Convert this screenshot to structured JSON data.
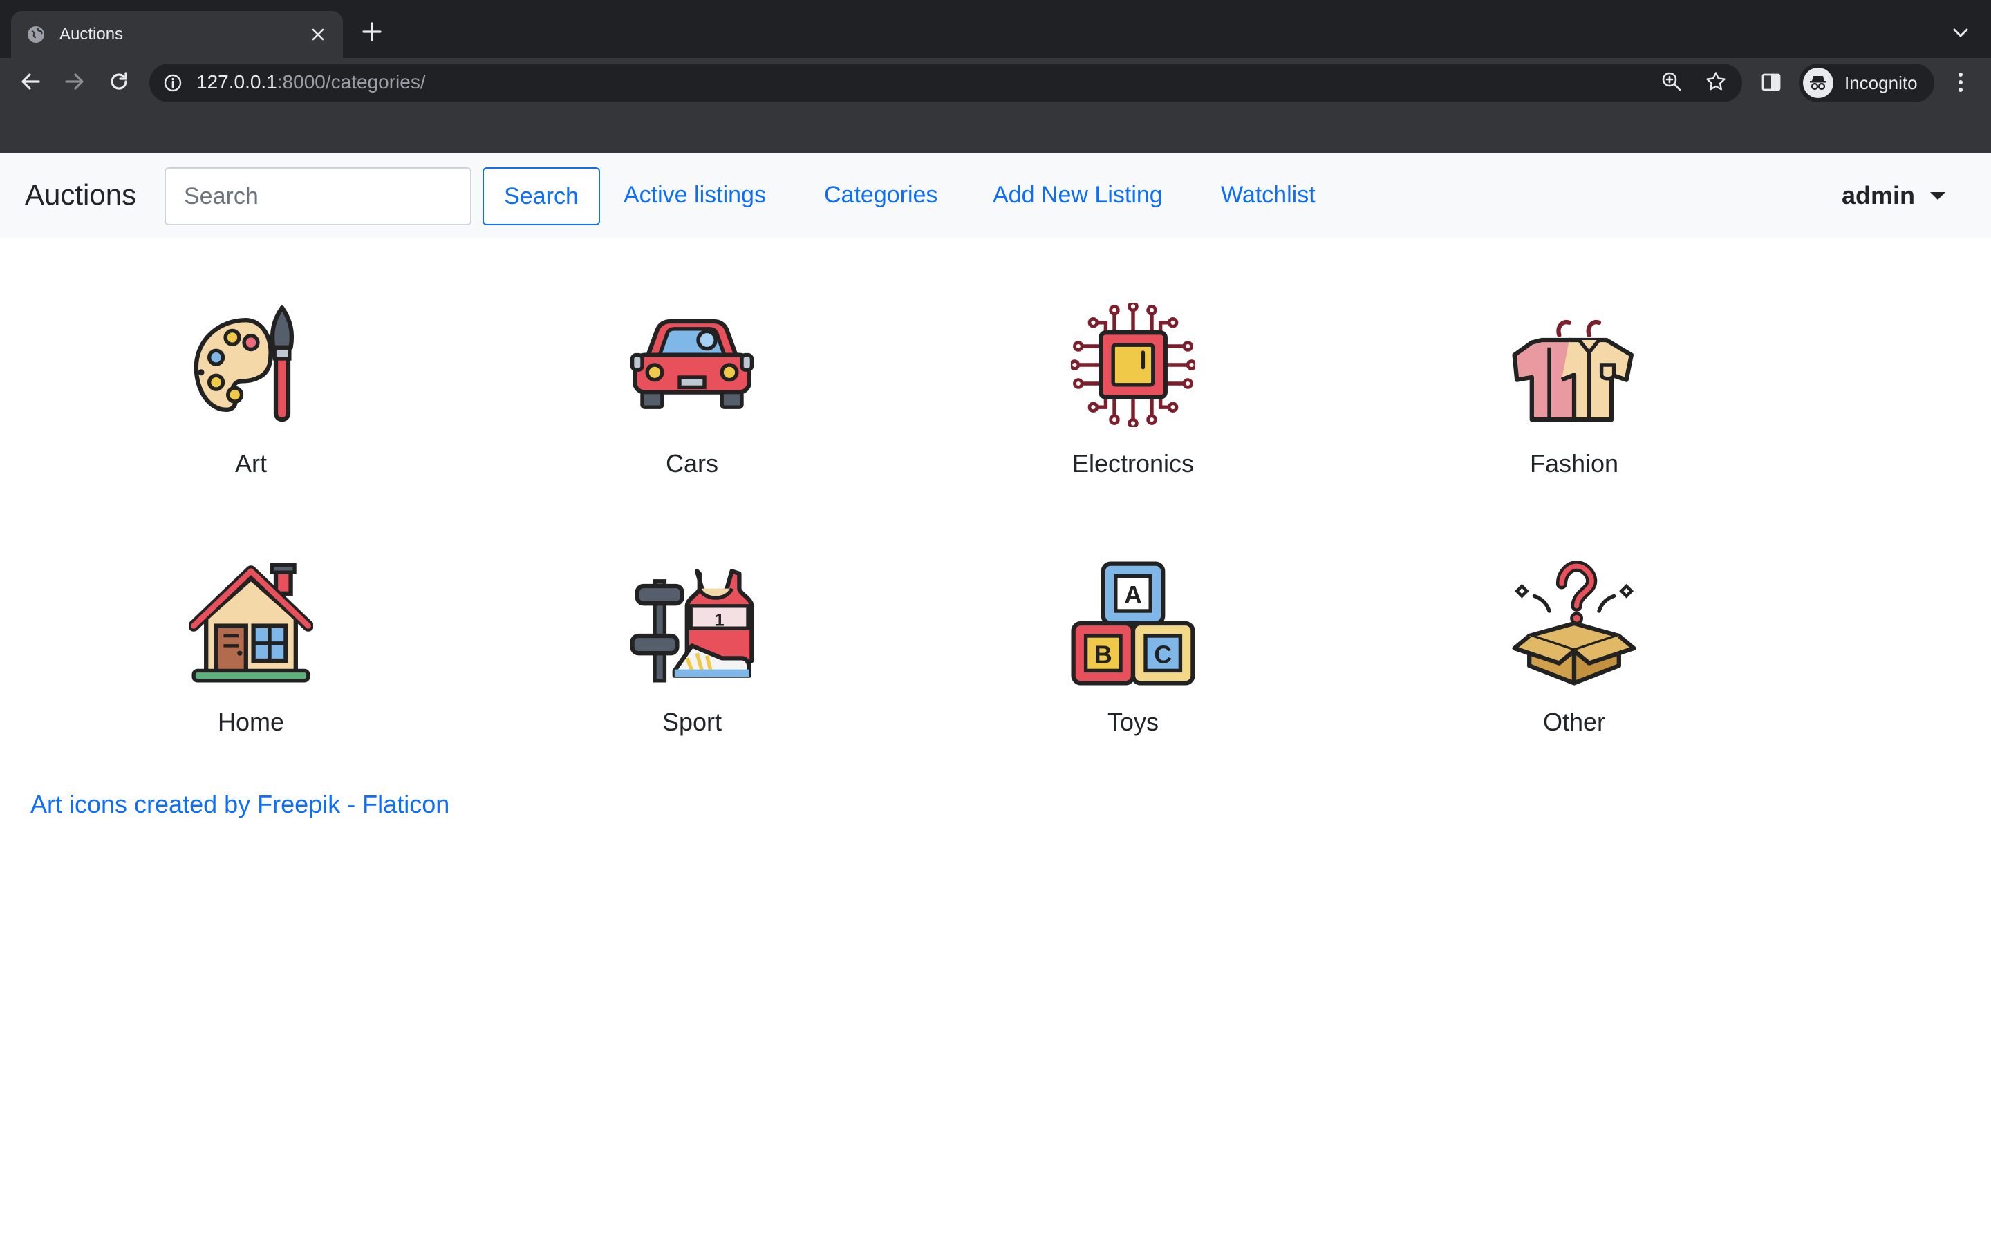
{
  "browser": {
    "tab_title": "Auctions",
    "url_host": "127.0.0.1",
    "url_path": ":8000/categories/",
    "profile_label": "Incognito",
    "icons": [
      "globe-icon",
      "close-icon",
      "plus-icon",
      "chevron-down-icon",
      "back-icon",
      "forward-icon",
      "reload-icon",
      "info-icon",
      "zoom-icon",
      "star-icon",
      "side-panel-icon",
      "incognito-icon",
      "more-icon"
    ]
  },
  "navbar": {
    "brand": "Auctions",
    "search_placeholder": "Search",
    "search_button": "Search",
    "links": [
      "Active listings",
      "Categories",
      "Add New Listing",
      "Watchlist"
    ],
    "user": "admin"
  },
  "categories": [
    {
      "label": "Art",
      "icon": "palette-icon"
    },
    {
      "label": "Cars",
      "icon": "car-icon"
    },
    {
      "label": "Electronics",
      "icon": "chip-icon"
    },
    {
      "label": "Fashion",
      "icon": "clothes-icon"
    },
    {
      "label": "Home",
      "icon": "house-icon"
    },
    {
      "label": "Sport",
      "icon": "sport-icon"
    },
    {
      "label": "Toys",
      "icon": "abc-blocks-icon"
    },
    {
      "label": "Other",
      "icon": "mystery-box-icon"
    }
  ],
  "credit": "Art icons created by Freepik - Flaticon",
  "colors": {
    "link": "#0d6efd",
    "navbar_bg": "#f8f9fa",
    "chrome_dark": "#202124",
    "chrome_toolbar": "#35363a"
  }
}
